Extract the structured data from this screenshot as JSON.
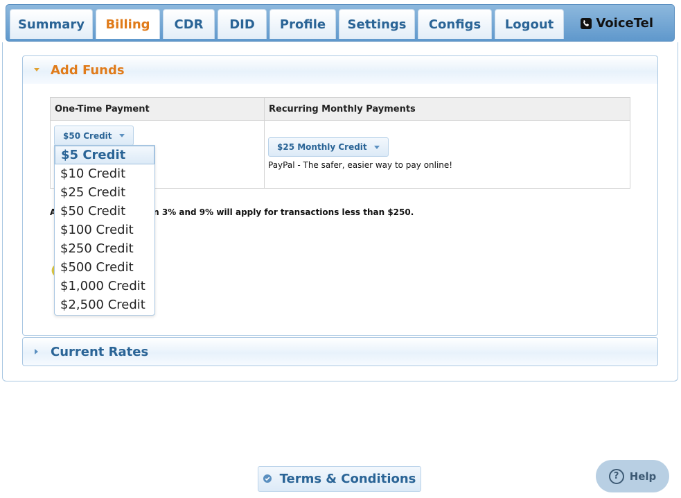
{
  "nav": {
    "tabs": [
      {
        "label": "Summary"
      },
      {
        "label": "Billing"
      },
      {
        "label": "CDR"
      },
      {
        "label": "DID"
      },
      {
        "label": "Profile"
      },
      {
        "label": "Settings"
      },
      {
        "label": "Configs"
      },
      {
        "label": "Logout"
      }
    ],
    "active_tab": "Billing",
    "brand": "VoiceTel",
    "brand_icon": "phone-icon"
  },
  "add_funds": {
    "title": "Add Funds",
    "expanded": true,
    "table": {
      "col1_header": "One-Time Payment",
      "col2_header": "Recurring Monthly Payments"
    },
    "one_time_selected": "$50 Credit",
    "monthly_selected": "$25 Monthly Credit",
    "paypal_text": "PayPal - The safer, easier way to pay online!",
    "fee_prefix": "A",
    "fee_text": " between 3% and 9% will apply for transactions less than $250.",
    "dropdown_options": [
      "$5 Credit",
      "$10 Credit",
      "$25 Credit",
      "$50 Credit",
      "$100 Credit",
      "$250 Credit",
      "$500 Credit",
      "$1,000 Credit",
      "$2,500 Credit"
    ],
    "highlighted_option": "$5 Credit"
  },
  "current_rates": {
    "title": "Current Rates",
    "expanded": false
  },
  "footer": {
    "terms_label": "Terms & Conditions",
    "help_label": "Help"
  },
  "colors": {
    "accent": "#e07b1a",
    "link": "#2a6496",
    "nav_bg": "#6fa3d3"
  }
}
